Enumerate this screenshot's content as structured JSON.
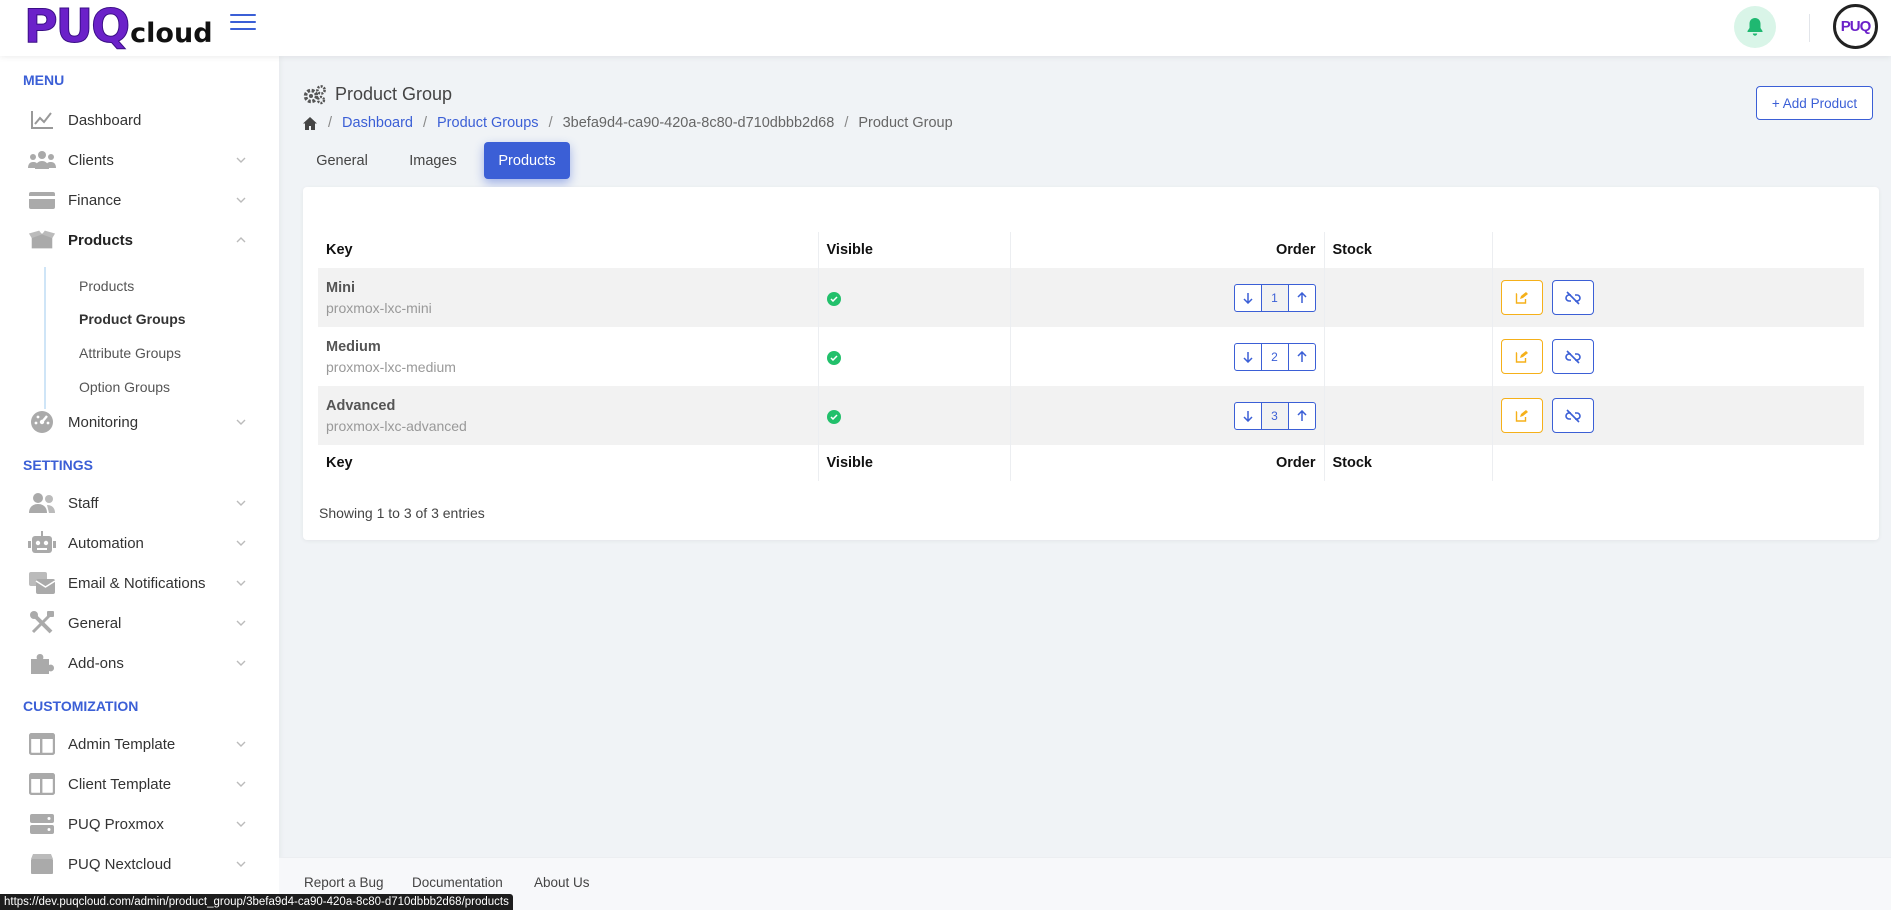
{
  "app": {
    "logo_main": "PUQ",
    "logo_sub": "cloud",
    "avatar_text": "PUQ"
  },
  "sidebar": {
    "menu_heading": "MENU",
    "settings_heading": "SETTINGS",
    "customization_heading": "CUSTOMIZATION",
    "items": [
      {
        "label": "Dashboard"
      },
      {
        "label": "Clients"
      },
      {
        "label": "Finance"
      },
      {
        "label": "Products"
      },
      {
        "label": "Monitoring"
      },
      {
        "label": "Staff"
      },
      {
        "label": "Automation"
      },
      {
        "label": "Email & Notifications"
      },
      {
        "label": "General"
      },
      {
        "label": "Add-ons"
      },
      {
        "label": "Admin Template"
      },
      {
        "label": "Client Template"
      },
      {
        "label": "PUQ Proxmox"
      },
      {
        "label": "PUQ Nextcloud"
      }
    ],
    "sub_items": [
      {
        "label": "Products"
      },
      {
        "label": "Product Groups"
      },
      {
        "label": "Attribute Groups"
      },
      {
        "label": "Option Groups"
      }
    ]
  },
  "page": {
    "title": "Product Group",
    "add_button": "+ Add Product",
    "breadcrumb": {
      "dashboard": "Dashboard",
      "product_groups": "Product Groups",
      "uuid": "3befa9d4-ca90-420a-8c80-d710dbbb2d68",
      "current": "Product Group"
    },
    "tabs": [
      {
        "label": "General"
      },
      {
        "label": "Images"
      },
      {
        "label": "Products"
      }
    ]
  },
  "table": {
    "headers": {
      "key": "Key",
      "visible": "Visible",
      "order": "Order",
      "stock": "Stock"
    },
    "rows": [
      {
        "name": "Mini",
        "code": "proxmox-lxc-mini",
        "order": "1"
      },
      {
        "name": "Medium",
        "code": "proxmox-lxc-medium",
        "order": "2"
      },
      {
        "name": "Advanced",
        "code": "proxmox-lxc-advanced",
        "order": "3"
      }
    ],
    "entries": "Showing 1 to 3 of 3 entries"
  },
  "footer": {
    "report": "Report a Bug",
    "docs": "Documentation",
    "about": "About Us"
  },
  "status_url": "https://dev.puqcloud.com/admin/product_group/3befa9d4-ca90-420a-8c80-d710dbbb2d68/products",
  "colors": {
    "accent": "#3b5fd6",
    "logo": "#6b21c9",
    "edit": "#f5b019",
    "success": "#22c06b"
  }
}
